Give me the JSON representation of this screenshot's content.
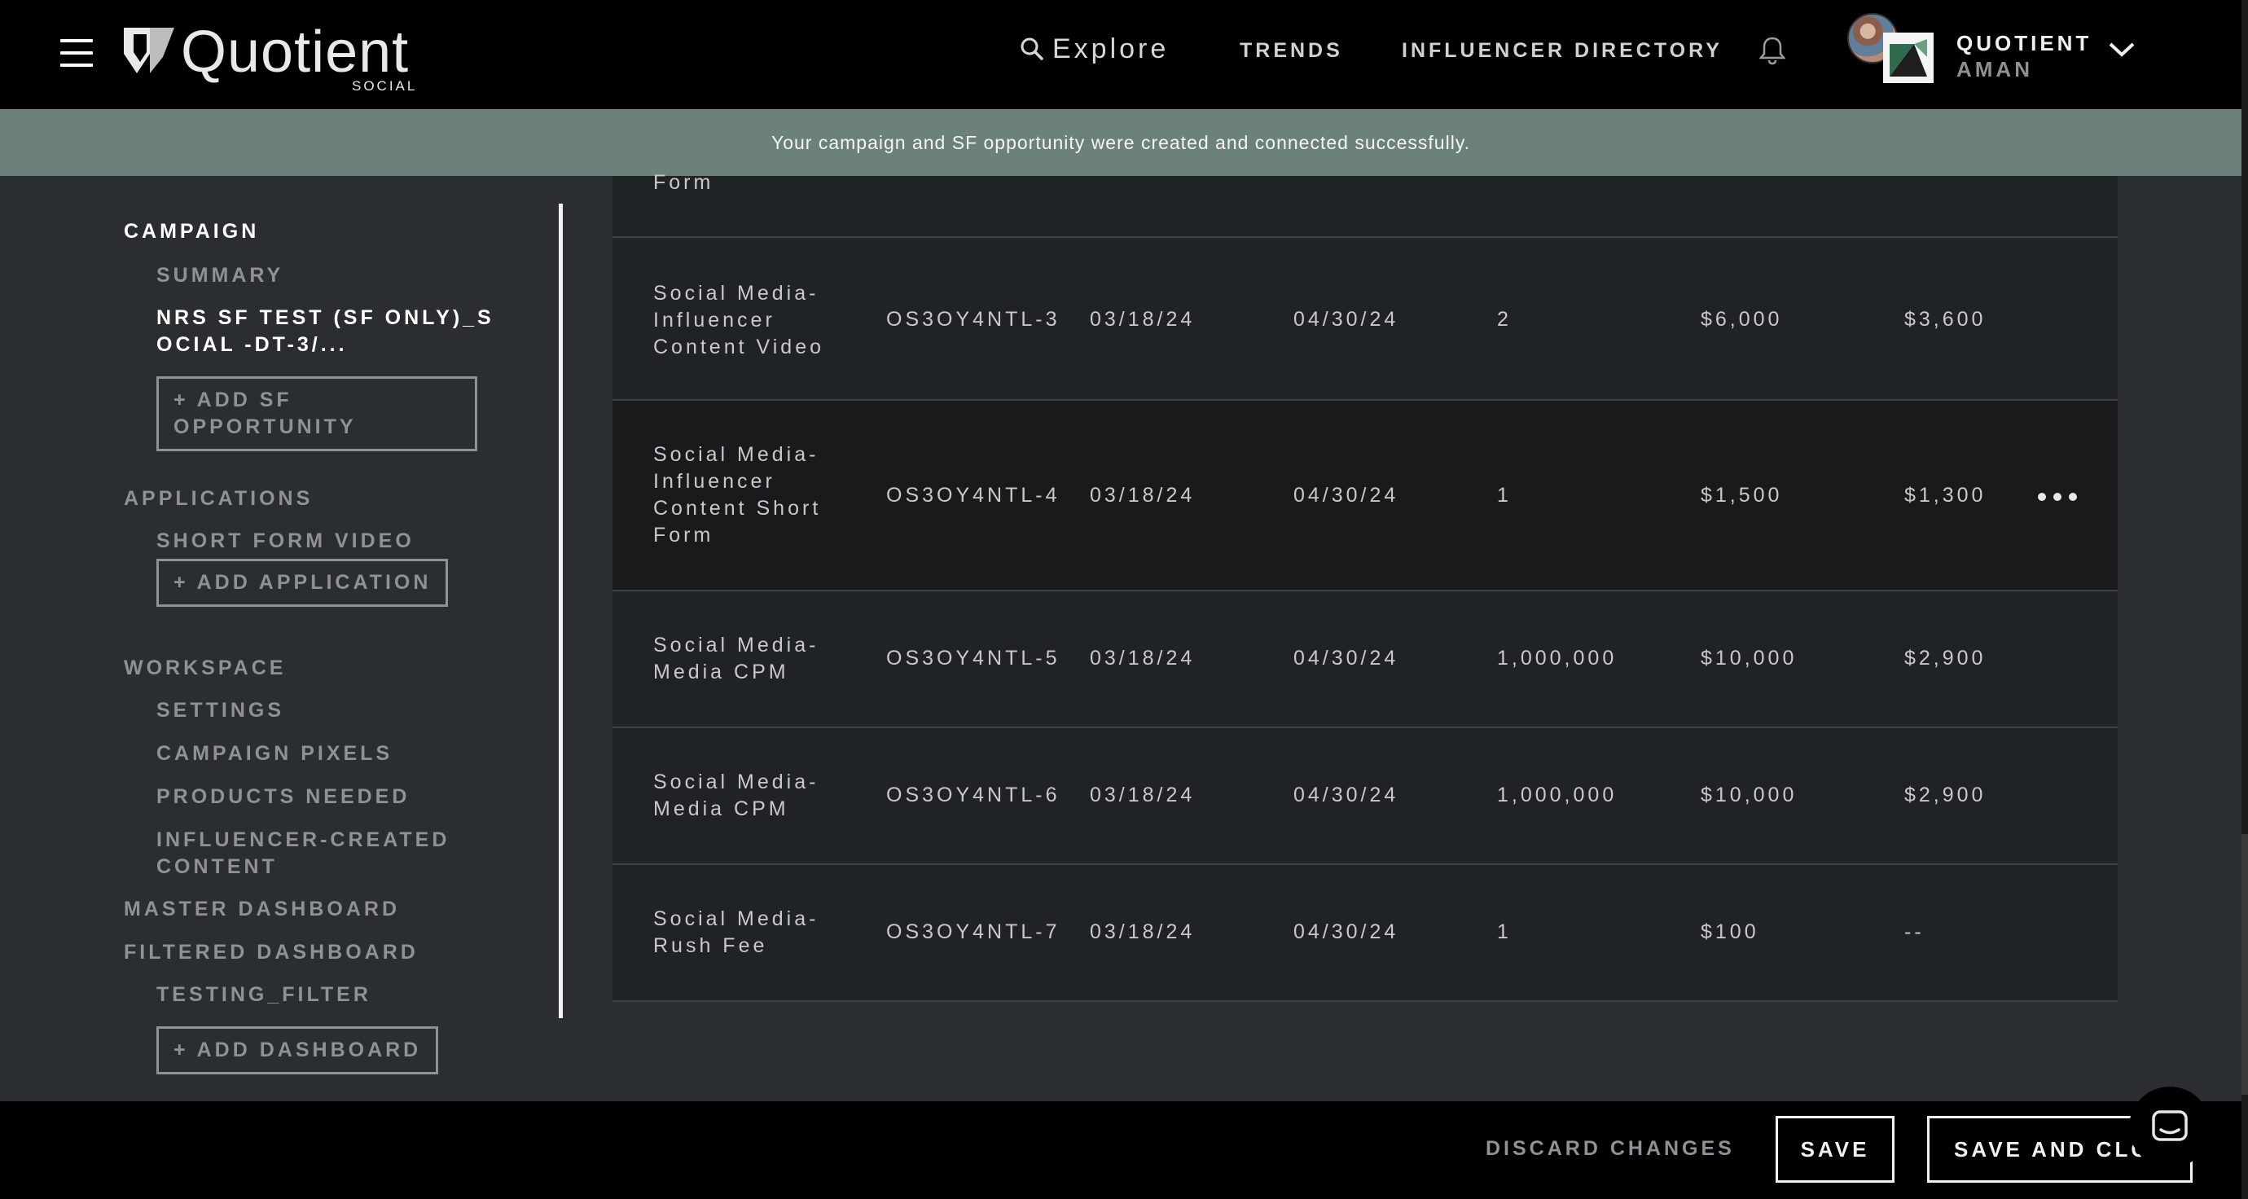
{
  "header": {
    "logo_text": "Quotient",
    "logo_sub": "SOCIAL",
    "explore_label": "Explore",
    "nav": [
      "TRENDS",
      "INFLUENCER DIRECTORY"
    ],
    "user_name": "QUOTIENT",
    "user_sub": "AMAN"
  },
  "banner": {
    "message": "Your campaign and SF opportunity were created and connected successfully."
  },
  "sidebar": {
    "campaign": "CAMPAIGN",
    "summary": "SUMMARY",
    "campaign_name_line1": "NRS SF TEST (SF ONLY)_S",
    "campaign_name_line2": "OCIAL -DT-3/...",
    "add_sf_line1": "+ ADD SF",
    "add_sf_line2": "OPPORTUNITY",
    "applications": "APPLICATIONS",
    "short_form_video": "SHORT FORM VIDEO",
    "add_application": "+ ADD APPLICATION",
    "workspace": "WORKSPACE",
    "settings": "SETTINGS",
    "campaign_pixels": "CAMPAIGN PIXELS",
    "products_needed": "PRODUCTS NEEDED",
    "influencer_content_line1": "INFLUENCER-CREATED",
    "influencer_content_line2": "CONTENT",
    "master_dashboard": "MASTER DASHBOARD",
    "filtered_dashboard": "FILTERED DASHBOARD",
    "testing_filter": "TESTING_FILTER",
    "add_dashboard": "+ ADD DASHBOARD"
  },
  "table": {
    "partial_row_text": "Form",
    "rows": [
      {
        "name": [
          "Social Media-",
          "Influencer",
          "Content Video"
        ],
        "id": "OS3OY4NTL-3",
        "start": "03/18/24",
        "end": "04/30/24",
        "qty": "2",
        "budget": "$6,000",
        "spend": "$3,600"
      },
      {
        "name": [
          "Social Media-",
          "Influencer",
          "Content Short",
          "Form"
        ],
        "id": "OS3OY4NTL-4",
        "start": "03/18/24",
        "end": "04/30/24",
        "qty": "1",
        "budget": "$1,500",
        "spend": "$1,300"
      },
      {
        "name": [
          "Social Media-",
          "Media CPM"
        ],
        "id": "OS3OY4NTL-5",
        "start": "03/18/24",
        "end": "04/30/24",
        "qty": "1,000,000",
        "budget": "$10,000",
        "spend": "$2,900"
      },
      {
        "name": [
          "Social Media-",
          "Media CPM"
        ],
        "id": "OS3OY4NTL-6",
        "start": "03/18/24",
        "end": "04/30/24",
        "qty": "1,000,000",
        "budget": "$10,000",
        "spend": "$2,900"
      },
      {
        "name": [
          "Social Media-",
          "Rush Fee"
        ],
        "id": "OS3OY4NTL-7",
        "start": "03/18/24",
        "end": "04/30/24",
        "qty": "1",
        "budget": "$100",
        "spend": "--"
      }
    ]
  },
  "footer": {
    "discard": "DISCARD CHANGES",
    "save": "SAVE",
    "save_and_close": "SAVE AND CLOSE"
  },
  "colors": {
    "banner": "#6c817b",
    "topbar": "#000000",
    "page": "#2a2d31",
    "row": "#202326",
    "row_hover": "#181a1c"
  },
  "icons": [
    "hamburger-icon",
    "search-icon",
    "bell-icon",
    "chevron-down-icon",
    "more-icon",
    "chat-icon"
  ]
}
